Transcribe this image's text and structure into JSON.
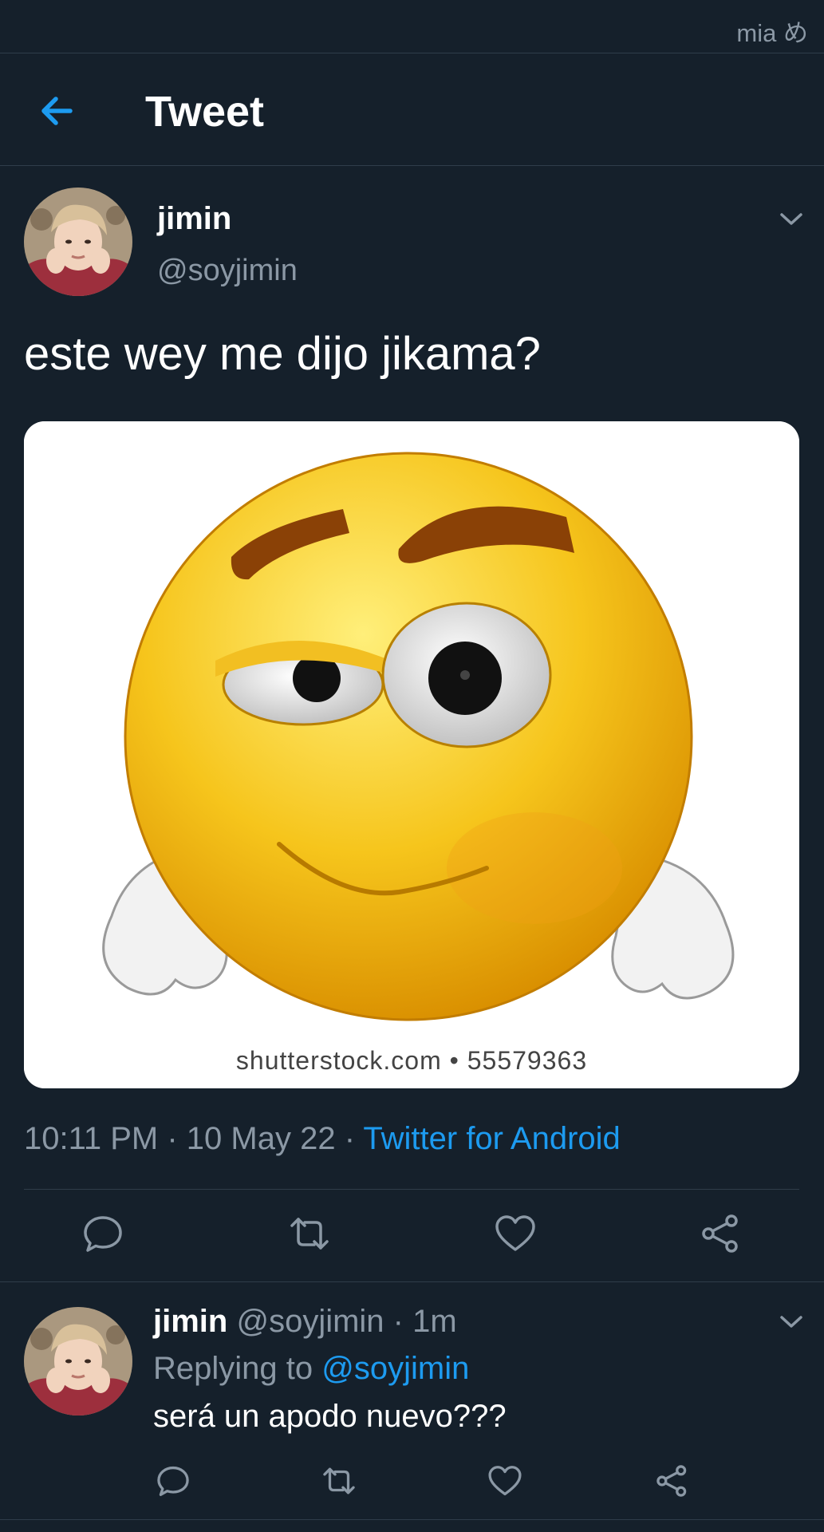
{
  "status_bar": {
    "user_label": "mia め"
  },
  "header": {
    "title": "Tweet",
    "back_icon": "arrow-left-icon"
  },
  "tweet": {
    "display_name": "jimin",
    "handle": "@soyjimin",
    "text": "este wey me dijo jikama?",
    "media_watermark": "shutterstock.com • 55579363",
    "time": "10:11 PM",
    "date": "10 May 22",
    "separator": " · ",
    "source": "Twitter for Android",
    "actions": [
      "reply-icon",
      "retweet-icon",
      "like-icon",
      "share-icon"
    ]
  },
  "reply": {
    "display_name": "jimin",
    "handle": "@soyjimin",
    "age": "1m",
    "separator": " · ",
    "replying_label": "Replying to",
    "replying_to": "@soyjimin",
    "text": "será un apodo nuevo???"
  },
  "colors": {
    "background": "#15202b",
    "accent": "#1d9bf0",
    "secondary_text": "#8b98a5",
    "divider": "#2f3d4a"
  }
}
